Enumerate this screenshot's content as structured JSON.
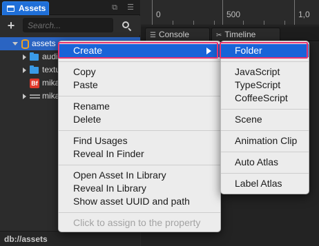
{
  "assets_panel": {
    "tab_title": "Assets",
    "search_placeholder": "Search...",
    "tree": [
      {
        "label": "assets",
        "icon": "database-icon",
        "expanded": true,
        "selected": true
      },
      {
        "label": "audio",
        "icon": "folder-icon"
      },
      {
        "label": "textures",
        "icon": "folder-icon"
      },
      {
        "label": "mikado",
        "icon": "bitmap-font-icon",
        "icon_text": "Bf"
      },
      {
        "label": "mikado",
        "icon": "prefab-icon"
      }
    ],
    "footer_path": "db://assets"
  },
  "timeline_ruler": {
    "labels": [
      "0",
      "500",
      "1,0"
    ]
  },
  "bottom_tabs": [
    {
      "label": "Console",
      "icon": "console-icon",
      "glyph": "☰"
    },
    {
      "label": "Timeline",
      "icon": "timeline-icon",
      "glyph": "✂"
    }
  ],
  "context_menu": {
    "items": [
      {
        "label": "Create",
        "active": true,
        "has_submenu": true
      },
      {
        "label": "Copy"
      },
      {
        "label": "Paste"
      },
      {
        "label": "Rename"
      },
      {
        "label": "Delete"
      },
      {
        "label": "Find Usages"
      },
      {
        "label": "Reveal In Finder"
      },
      {
        "label": "Open Asset In Library"
      },
      {
        "label": "Reveal In Library"
      },
      {
        "label": "Show asset UUID and path"
      },
      {
        "label": "Click to assign to the property",
        "disabled": true
      }
    ]
  },
  "create_submenu": {
    "items": [
      {
        "label": "Folder",
        "active": true
      },
      {
        "label": "JavaScript"
      },
      {
        "label": "TypeScript"
      },
      {
        "label": "CoffeeScript"
      },
      {
        "label": "Scene"
      },
      {
        "label": "Animation Clip"
      },
      {
        "label": "Auto Atlas"
      },
      {
        "label": "Label Atlas"
      }
    ]
  },
  "colors": {
    "accent_blue": "#1863d8",
    "highlight_pink": "#e8336e",
    "panel_bg": "#2c2c2c",
    "menu_bg": "#ececec"
  }
}
